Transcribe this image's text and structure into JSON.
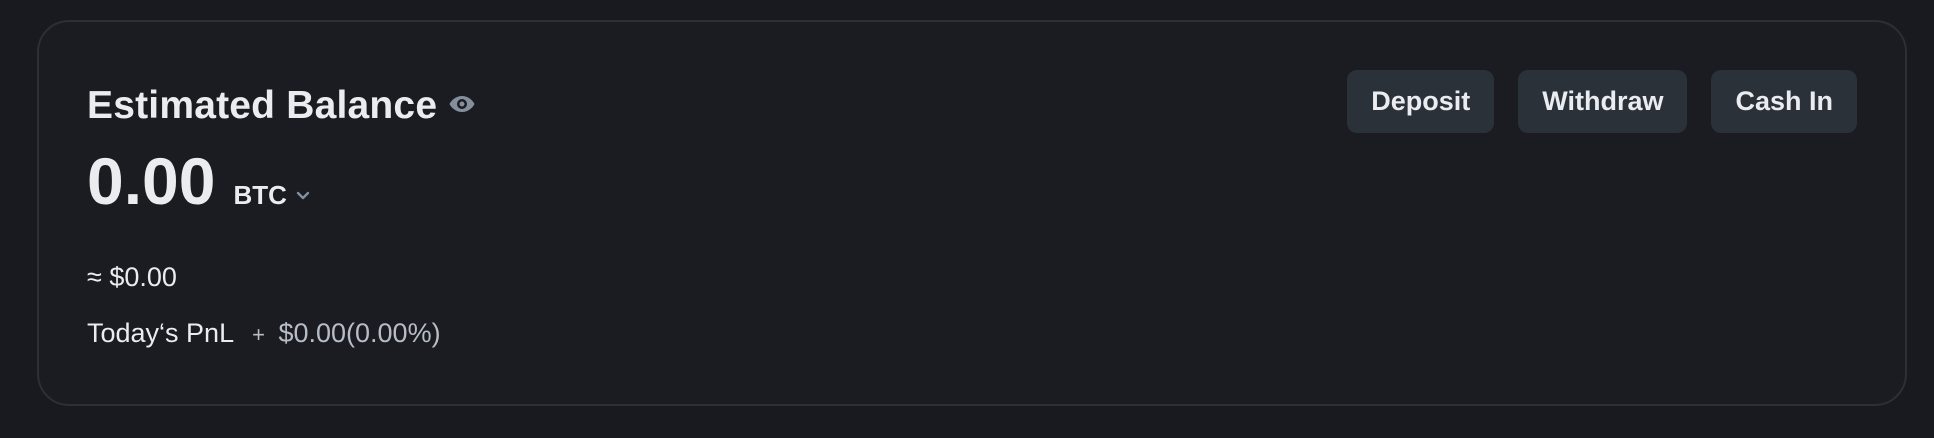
{
  "balance": {
    "title": "Estimated Balance",
    "amount": "0.00",
    "unit": "BTC",
    "fiat": "≈ $0.00",
    "pnl_label": "Today‘s PnL",
    "pnl_sign": "+",
    "pnl_value": "$0.00(0.00%)"
  },
  "actions": {
    "deposit": "Deposit",
    "withdraw": "Withdraw",
    "cash_in": "Cash In"
  },
  "icons": {
    "visibility": "eye-icon",
    "unit_dropdown": "chevron-down-icon"
  },
  "colors": {
    "background": "#181a20",
    "card": "#1b1c21",
    "border": "#2b2f36",
    "button": "#2b3139",
    "text_primary": "#eaecef",
    "text_secondary": "#b7bdc6",
    "icon": "#848e9c"
  }
}
